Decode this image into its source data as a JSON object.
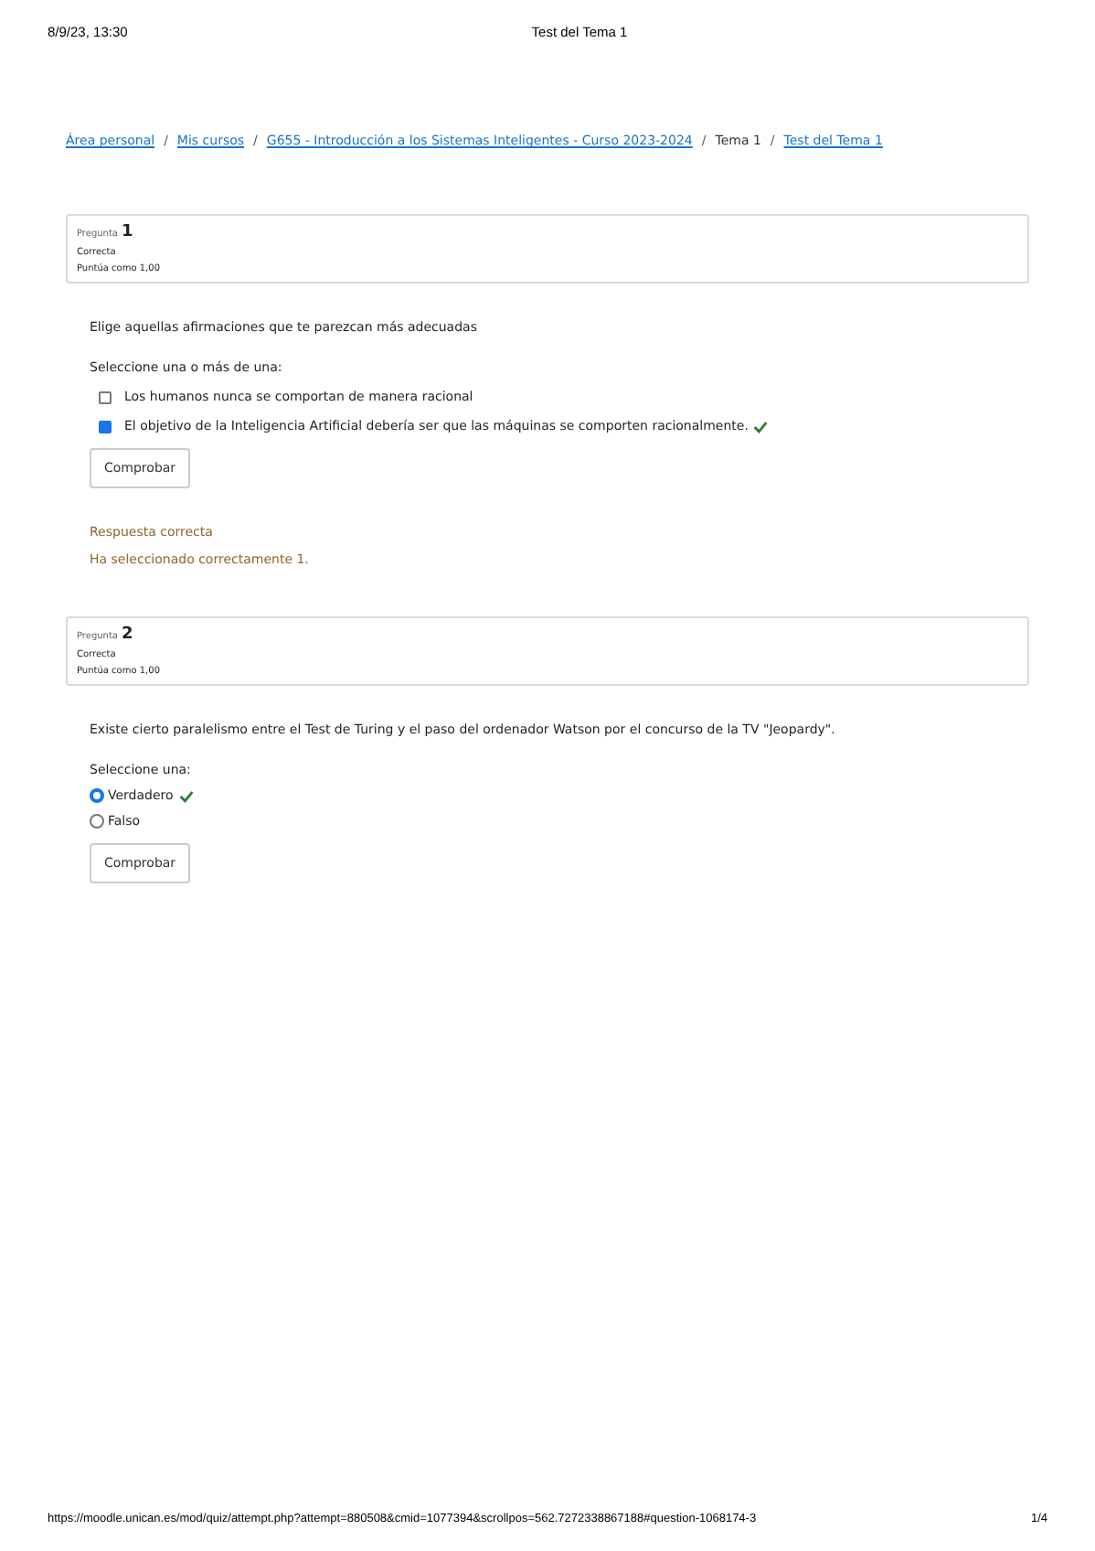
{
  "print_header": {
    "date": "8/9/23, 13:30",
    "title": "Test del Tema 1"
  },
  "breadcrumb": [
    {
      "label": "Área personal",
      "kind": "link"
    },
    {
      "label": "/",
      "kind": "separator"
    },
    {
      "label": "Mis cursos",
      "kind": "link"
    },
    {
      "label": "/",
      "kind": "separator"
    },
    {
      "label": "G655 - Introducción a los Sistemas Inteligentes - Curso 2023-2024",
      "kind": "link"
    },
    {
      "label": "/",
      "kind": "separator"
    },
    {
      "label": "Tema 1",
      "kind": "text"
    },
    {
      "label": "/",
      "kind": "separator"
    },
    {
      "label": "Test del Tema 1",
      "kind": "link"
    }
  ],
  "questions": [
    {
      "label": "Pregunta",
      "number": "1",
      "status": "Correcta",
      "score": "Puntúa como 1,00",
      "text": "Elige aquellas afirmaciones que te parezcan más adecuadas",
      "prompt": "Seleccione una o más de una:",
      "kind": "multi",
      "options": [
        {
          "label": "Los humanos nunca se comportan de manera racional",
          "selected": false,
          "correct": false
        },
        {
          "label": "El objetivo de la Inteligencia Artificial debería ser que las máquinas se comporten racionalmente.",
          "selected": true,
          "correct": true
        }
      ],
      "button": "Comprobar",
      "feedback": [
        "Respuesta correcta",
        "Ha seleccionado correctamente 1."
      ]
    },
    {
      "label": "Pregunta",
      "number": "2",
      "status": "Correcta",
      "score": "Puntúa como 1,00",
      "text": "Existe cierto paralelismo entre el Test de Turing y el paso del ordenador Watson por el concurso de la TV \"Jeopardy\".",
      "prompt": "Seleccione una:",
      "kind": "single",
      "options": [
        {
          "label": "Verdadero",
          "selected": true,
          "correct": true
        },
        {
          "label": "Falso",
          "selected": false,
          "correct": false
        }
      ],
      "button": "Comprobar"
    }
  ],
  "print_footer": {
    "url": "https://moodle.unican.es/mod/quiz/attempt.php?attempt=880508&cmid=1077394&scrollpos=562.7272338867188#question-1068174-3",
    "page": "1/4"
  }
}
